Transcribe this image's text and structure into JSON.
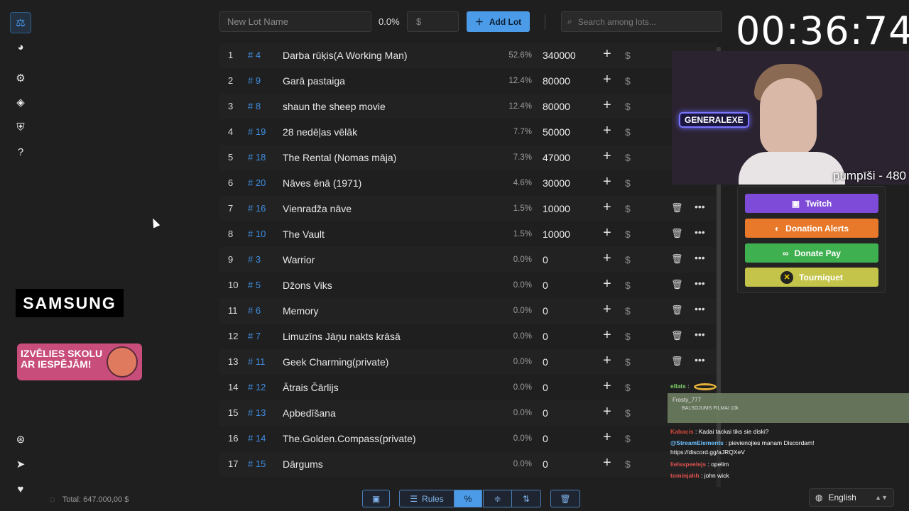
{
  "sidebar": {
    "items": [
      {
        "name": "auction-icon",
        "glyph": "⚖"
      },
      {
        "name": "wheel-icon",
        "glyph": "◕"
      },
      {
        "name": "settings-icon",
        "glyph": "⚙"
      },
      {
        "name": "layers-icon",
        "glyph": "◈"
      },
      {
        "name": "shield-icon",
        "glyph": "⛨"
      },
      {
        "name": "help-icon",
        "glyph": "?"
      }
    ],
    "bottom": [
      {
        "name": "github-icon",
        "glyph": "⊛"
      },
      {
        "name": "telegram-icon",
        "glyph": "➤"
      },
      {
        "name": "donate-hand-icon",
        "glyph": "♥"
      }
    ]
  },
  "ads": {
    "samsung": "SAMSUNG",
    "promo_line1": "IZVĒLIES SKOLU",
    "promo_line2": "AR IESPĒJĀM!"
  },
  "total": {
    "label": "Total: 647.000,00 $"
  },
  "topbar": {
    "name_placeholder": "New Lot Name",
    "percent": "0.0%",
    "amount_placeholder": "$",
    "add_label": "Add Lot",
    "search_placeholder": "Search among lots..."
  },
  "timer": "00:36:74",
  "lots": [
    {
      "n": "1",
      "id": "# 4",
      "name": "Darba rūķis(A Working Man)",
      "pct": "52.6%",
      "amount": "340000"
    },
    {
      "n": "2",
      "id": "# 9",
      "name": "Garā pastaiga",
      "pct": "12.4%",
      "amount": "80000"
    },
    {
      "n": "3",
      "id": "# 8",
      "name": "shaun the sheep movie",
      "pct": "12.4%",
      "amount": "80000"
    },
    {
      "n": "4",
      "id": "# 19",
      "name": "28 nedēļas vēlāk",
      "pct": "7.7%",
      "amount": "50000"
    },
    {
      "n": "5",
      "id": "# 18",
      "name": "The Rental (Nomas māja)",
      "pct": "7.3%",
      "amount": "47000"
    },
    {
      "n": "6",
      "id": "# 20",
      "name": "Nāves ēnā (1971)",
      "pct": "4.6%",
      "amount": "30000"
    },
    {
      "n": "7",
      "id": "# 16",
      "name": "Vienradža nāve",
      "pct": "1.5%",
      "amount": "10000"
    },
    {
      "n": "8",
      "id": "# 10",
      "name": "The Vault",
      "pct": "1.5%",
      "amount": "10000"
    },
    {
      "n": "9",
      "id": "# 3",
      "name": "Warrior",
      "pct": "0.0%",
      "amount": "0"
    },
    {
      "n": "10",
      "id": "# 5",
      "name": "Džons Viks",
      "pct": "0.0%",
      "amount": "0"
    },
    {
      "n": "11",
      "id": "# 6",
      "name": "Memory",
      "pct": "0.0%",
      "amount": "0"
    },
    {
      "n": "12",
      "id": "# 7",
      "name": "Limuzīns Jāņu nakts krāsā",
      "pct": "0.0%",
      "amount": "0"
    },
    {
      "n": "13",
      "id": "# 11",
      "name": "Geek Charming(private)",
      "pct": "0.0%",
      "amount": "0"
    },
    {
      "n": "14",
      "id": "# 12",
      "name": "Ātrais Čārlijs",
      "pct": "0.0%",
      "amount": "0"
    },
    {
      "n": "15",
      "id": "# 13",
      "name": "Apbedīšana",
      "pct": "0.0%",
      "amount": "0"
    },
    {
      "n": "16",
      "id": "# 14",
      "name": "The.Golden.Compass(private)",
      "pct": "0.0%",
      "amount": "0"
    },
    {
      "n": "17",
      "id": "# 15",
      "name": "Dārgums",
      "pct": "0.0%",
      "amount": "0"
    }
  ],
  "stream": {
    "sign_text": "GENERALEXE",
    "caption": "pumpīši - 480"
  },
  "donations": {
    "twitch": "Twitch",
    "donation_alerts": "Donation Alerts",
    "donate_pay": "Donate Pay",
    "tourniquet": "Tourniquet"
  },
  "chat": {
    "c1_user": "ellats",
    "box_user": "Frosty_777",
    "box_msg": "BALSOJUMS FILMAI 10k",
    "l1_user": "Kabacis",
    "l1_msg": ": Kadai tackai tiks sie diski?",
    "l2_user": "@StreamElements",
    "l2_msg": ": pievienojies manam Discordam!",
    "l3_msg": "https://discord.gg/aJRQXeV",
    "l4_user": "lielsspeelejs",
    "l4_msg": ": opelim",
    "l5_user": "tominjahh",
    "l5_msg": ": john wick"
  },
  "language": "English",
  "toolbar": {
    "rules_label": "Rules"
  },
  "colors": {
    "accent": "#4c9be8",
    "background": "#1f1f1f",
    "twitch": "#7d4bd8",
    "donation_alerts": "#e8792a",
    "donate_pay": "#3fb04f",
    "tourniquet": "#c4c44a"
  }
}
